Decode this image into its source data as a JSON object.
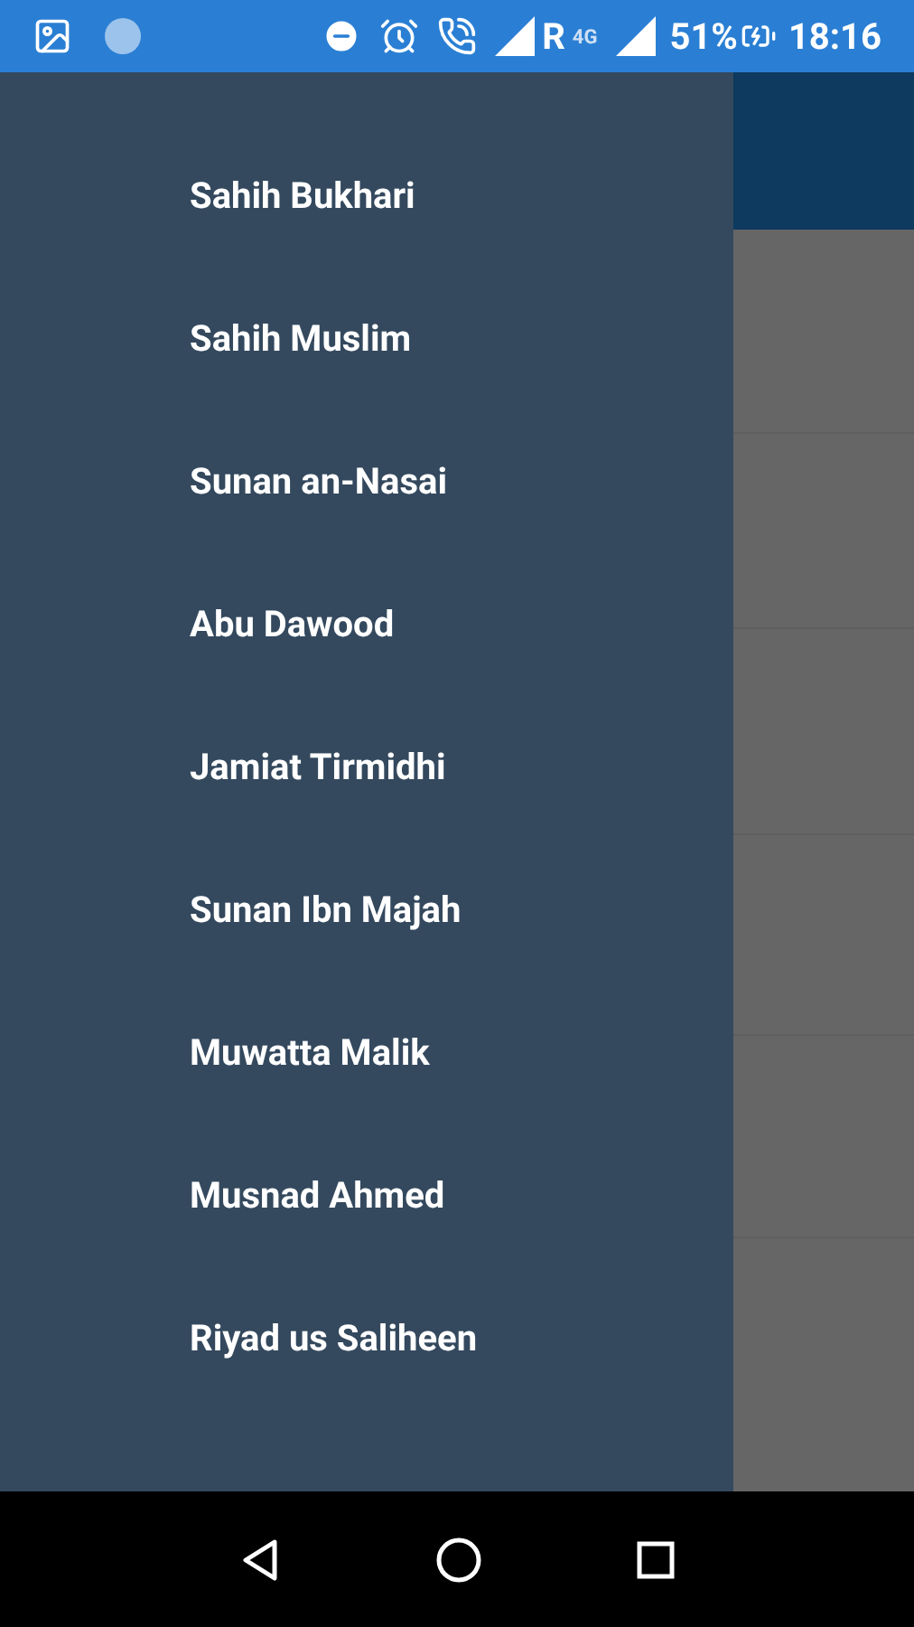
{
  "status_bar": {
    "roaming": "R",
    "network": "4G",
    "battery": "51%",
    "time": "18:16"
  },
  "drawer": {
    "items": [
      {
        "label": "Sahih Bukhari"
      },
      {
        "label": "Sahih Muslim"
      },
      {
        "label": "Sunan an-Nasai"
      },
      {
        "label": "Abu Dawood"
      },
      {
        "label": "Jamiat Tirmidhi"
      },
      {
        "label": "Sunan Ibn Majah"
      },
      {
        "label": "Muwatta Malik"
      },
      {
        "label": "Musnad Ahmed"
      },
      {
        "label": "Riyad us Saliheen"
      }
    ]
  }
}
